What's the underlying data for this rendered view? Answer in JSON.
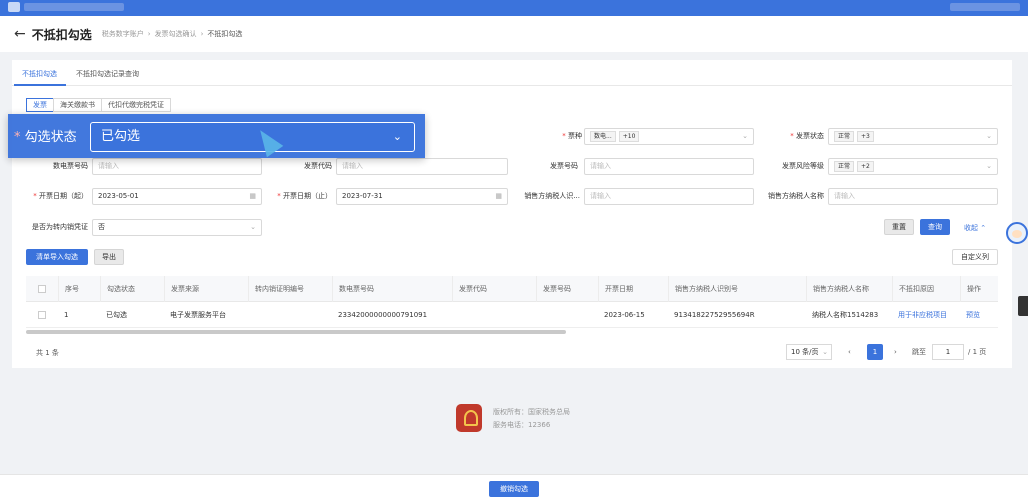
{
  "header": {
    "title": "不抵扣勾选",
    "breadcrumb": [
      "税务数字账户",
      "发票勾选确认",
      "不抵扣勾选"
    ]
  },
  "tabs": [
    "不抵扣勾选",
    "不抵扣勾选记录查询"
  ],
  "subtabs": [
    "发票",
    "海关缴款书",
    "代扣代缴完税凭证"
  ],
  "highlight": {
    "label": "勾选状态",
    "value": "已勾选"
  },
  "filters": {
    "ticket_type_label": "票种",
    "ticket_type_tag": "数电...",
    "ticket_type_more": "+10",
    "invoice_status_label": "发票状态",
    "invoice_status_tag": "正常",
    "invoice_status_more": "+3",
    "digital_no_label": "数电票号码",
    "invoice_code_label": "发票代码",
    "invoice_no_label": "发票号码",
    "risk_level_label": "发票风险等级",
    "risk_level_tag": "正常",
    "risk_level_more": "+2",
    "start_date_label": "开票日期（起）",
    "start_date_value": "2023-05-01",
    "end_date_label": "开票日期（止）",
    "end_date_value": "2023-07-31",
    "seller_id_label": "销售方纳税人识...",
    "seller_name_label": "销售方纳税人名称",
    "transfer_label": "是否为转内销凭证",
    "transfer_value": "否",
    "placeholder": "请输入"
  },
  "actions": {
    "reset": "重置",
    "query": "查询",
    "collapse": "收起",
    "import": "清单导入勾选",
    "export": "导出",
    "custom_columns": "自定义列"
  },
  "table": {
    "columns": [
      "序号",
      "勾选状态",
      "发票来源",
      "转内销证明编号",
      "数电票号码",
      "发票代码",
      "发票号码",
      "开票日期",
      "销售方纳税人识别号",
      "销售方纳税人名称",
      "不抵扣原因",
      "操作"
    ],
    "rows": [
      {
        "index": "1",
        "status": "已勾选",
        "source": "电子发票服务平台",
        "transfer_no": "",
        "digital_no": "23342000000000791091",
        "code": "",
        "number": "",
        "date": "2023-06-15",
        "seller_id": "91341822752955694R",
        "seller_name": "纳税人名称1514283",
        "reason": "用于非应税项目",
        "op": "预览"
      }
    ]
  },
  "pagination": {
    "total": "共 1 条",
    "page_size": "10 条/页",
    "current": "1",
    "goto_label": "跳至",
    "goto_value": "1",
    "pages": "/ 1 页"
  },
  "footer": {
    "copyright": "版权所有：国家税务总局",
    "phone": "服务电话：12366"
  },
  "bottom": {
    "submit": "撤销勾选"
  }
}
